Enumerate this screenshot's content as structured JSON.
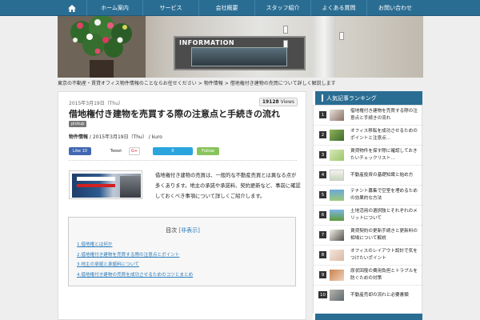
{
  "nav": {
    "items": [
      "ホーム案内",
      "サービス",
      "会社概要",
      "スタッフ紹介",
      "よくある質問",
      "お問い合わせ"
    ]
  },
  "hero": {
    "sign": "INFORMATION"
  },
  "breadcrumb": {
    "home": "東京の不動産・賃貸オフィス物件情報のことならお任せください",
    "category": "物件情報",
    "current": "借地権付き建物の売買について詳しく解説します"
  },
  "post": {
    "date": "2015年3月19日（Thu）",
    "views_count": "19128",
    "views_label": "Views",
    "title": "借地権付き建物を売買する際の注意点と手続きの流れ",
    "pickup": "pickup",
    "category": "物件情報",
    "meta_date": "2015年3月19日（Thu）",
    "author": "kuro",
    "intro": "借地権付き建物の売買は、一般的な不動産売買とは異なる点が多くあります。地主の承諾や承諾料、契約更新など、事前に確認しておくべき事項について詳しくご紹介します。"
  },
  "social": {
    "fb": "Like 10",
    "tw": "Tweet",
    "gp": "G+",
    "hb": "0",
    "follow": "Follow"
  },
  "toc": {
    "title": "目次",
    "toggle": "[非表示]",
    "items": [
      "1.借地権とは何か",
      "2.借地権付き建物を売買する際の注意点とポイント",
      "3.地主の承諾と承諾料について",
      "4.借地権付き建物の売買を成功させるためのコツとまとめ"
    ]
  },
  "sidebar": {
    "heading": "人気記事ランキング",
    "ranking": [
      {
        "num": "1",
        "title": "借地権付き建物を売買する際の注意点と手続きの流れ"
      },
      {
        "num": "2",
        "title": "オフィス移転を成功させるためのポイントと注意点…"
      },
      {
        "num": "3",
        "title": "賃貸物件を探す際に確認しておきたいチェックリスト…"
      },
      {
        "num": "4",
        "title": "不動産投資の基礎知識と始め方"
      },
      {
        "num": "5",
        "title": "テナント募集で空室を埋めるための効果的な方法"
      },
      {
        "num": "6",
        "title": "土地活用の選択肢とそれぞれのメリットについて"
      },
      {
        "num": "7",
        "title": "賃貸契約の更新手続きと更新料の相場について解説"
      },
      {
        "num": "8",
        "title": "オフィスのレイアウト設計で気をつけたいポイント"
      },
      {
        "num": "9",
        "title": "原状回復の費用負担とトラブルを防ぐための対策"
      },
      {
        "num": "10",
        "title": "不動産売却の流れと必要書類"
      }
    ]
  }
}
